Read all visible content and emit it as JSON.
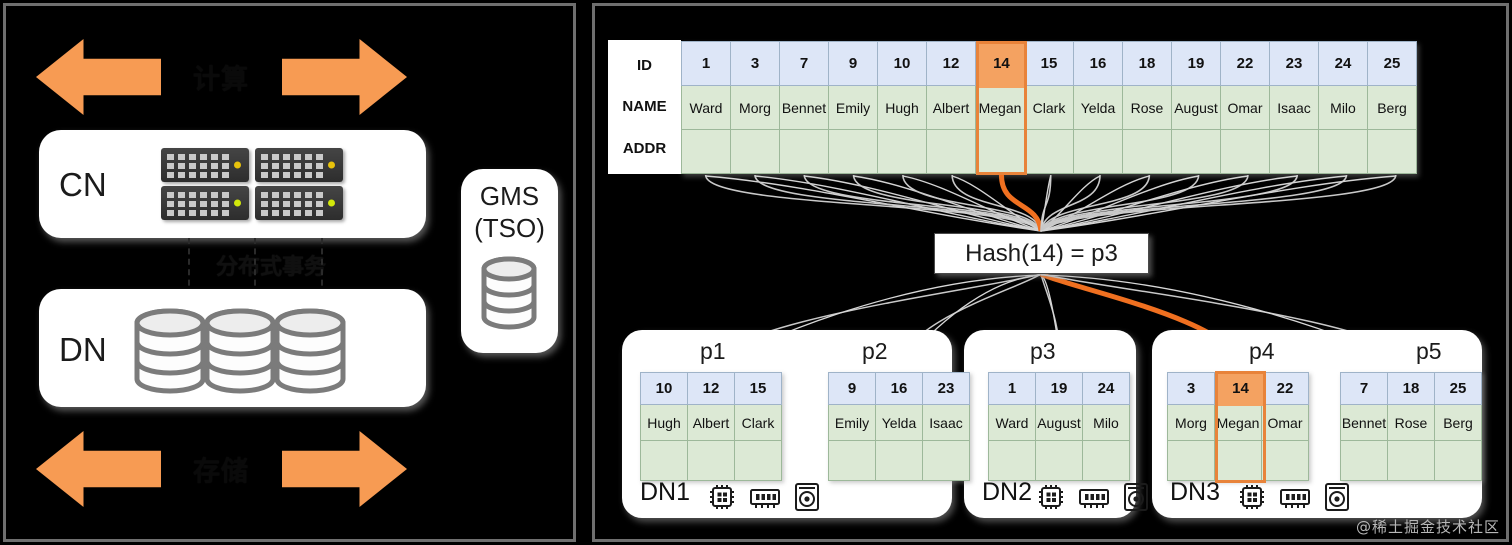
{
  "left_panel": {
    "top_arrows": {
      "left_icon": "arrow-left",
      "right_icon": "arrow-right",
      "label": "计算"
    },
    "bottom_arrows": {
      "left_icon": "arrow-left",
      "right_icon": "arrow-right",
      "label": "存储"
    },
    "cn_box": {
      "label": "CN",
      "node_count": 4,
      "node_icon": "server-blade-icon"
    },
    "dn_box": {
      "label": "DN",
      "node_count": 3,
      "node_icon": "database-cylinder-icon"
    },
    "middle_label": "分布式事务",
    "gms_box": {
      "line1": "GMS",
      "line2": "(TSO)",
      "icon": "database-cylinder-icon"
    }
  },
  "right_panel": {
    "table": {
      "row_labels": [
        "ID",
        "NAME",
        "ADDR"
      ],
      "ids": [
        "1",
        "3",
        "7",
        "9",
        "10",
        "12",
        "14",
        "15",
        "16",
        "18",
        "19",
        "22",
        "23",
        "24",
        "25"
      ],
      "names": [
        "Ward",
        "Morg",
        "Bennet",
        "Emily",
        "Hugh",
        "Albert",
        "Megan",
        "Clark",
        "Yelda",
        "Rose",
        "August",
        "Omar",
        "Isaac",
        "Milo",
        "Berg"
      ],
      "addrs": [
        "",
        "",
        "",
        "",
        "",
        "",
        "",
        "",
        "",
        "",
        "",
        "",
        "",
        "",
        ""
      ],
      "highlighted_id": "14",
      "highlighted_index": 6
    },
    "hash_box": {
      "text": "Hash(14) = p3"
    },
    "colors": {
      "id_row_bg": "#dde6f7",
      "name_row_bg": "#dce9d5",
      "highlight_fill": "#F4A261",
      "highlight_border": "#E8833A",
      "arrow_orange": "#F79B53"
    },
    "dn_nodes": [
      {
        "name": "DN1",
        "hw_icons": [
          "cpu-icon",
          "ram-icon",
          "disk-icon"
        ],
        "partitions": [
          {
            "title": "p1",
            "ids": [
              "10",
              "12",
              "15"
            ],
            "names": [
              "Hugh",
              "Albert",
              "Clark"
            ],
            "addrs": [
              "",
              "",
              ""
            ]
          },
          {
            "title": "p2",
            "ids": [
              "9",
              "16",
              "23"
            ],
            "names": [
              "Emily",
              "Yelda",
              "Isaac"
            ],
            "addrs": [
              "",
              "",
              ""
            ]
          }
        ]
      },
      {
        "name": "DN2",
        "hw_icons": [
          "cpu-icon",
          "ram-icon",
          "disk-icon"
        ],
        "partitions": [
          {
            "title": "p3",
            "ids": [
              "1",
              "19",
              "24"
            ],
            "names": [
              "Ward",
              "August",
              "Milo"
            ],
            "addrs": [
              "",
              "",
              ""
            ]
          }
        ]
      },
      {
        "name": "DN3",
        "hw_icons": [
          "cpu-icon",
          "ram-icon",
          "disk-icon"
        ],
        "partitions": [
          {
            "title": "p4",
            "ids": [
              "3",
              "14",
              "22"
            ],
            "names": [
              "Morg",
              "Megan",
              "Omar"
            ],
            "addrs": [
              "",
              "",
              ""
            ],
            "highlighted_index": 1
          },
          {
            "title": "p5",
            "ids": [
              "7",
              "18",
              "25"
            ],
            "names": [
              "Bennet",
              "Rose",
              "Berg"
            ],
            "addrs": [
              "",
              "",
              ""
            ]
          }
        ]
      }
    ]
  },
  "watermark": "@稀土掘金技术社区"
}
